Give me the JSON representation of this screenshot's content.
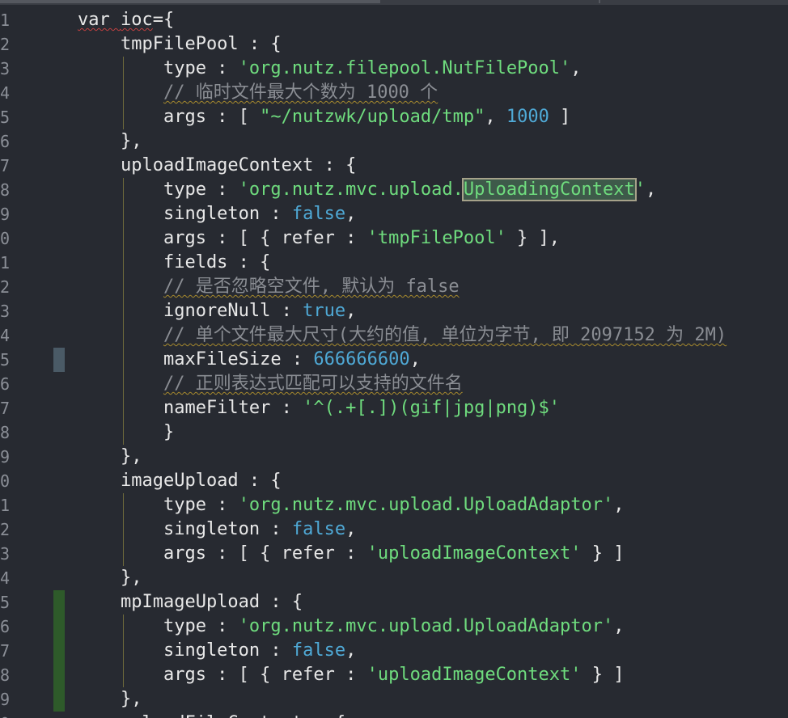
{
  "editor": {
    "lines": [
      {
        "n": "1",
        "tokens": [
          {
            "t": "var ",
            "c": "kw",
            "sq": "red"
          },
          {
            "t": "ioc",
            "c": "kw",
            "sq": "red"
          },
          {
            "t": "={",
            "c": "kw"
          }
        ]
      },
      {
        "n": "2",
        "tokens": [
          {
            "t": "    tmpFilePool : {",
            "c": "kw"
          }
        ]
      },
      {
        "n": "3",
        "tokens": [
          {
            "t": "        type : ",
            "c": "kw"
          },
          {
            "t": "'org.nutz.filepool.NutFilePool'",
            "c": "str"
          },
          {
            "t": ",",
            "c": "kw"
          }
        ]
      },
      {
        "n": "4",
        "tokens": [
          {
            "t": "        ",
            "c": "kw"
          },
          {
            "t": "// 临时文件最大个数为 1000 个",
            "c": "cmt",
            "sq": "y"
          }
        ]
      },
      {
        "n": "5",
        "tokens": [
          {
            "t": "        args : [ ",
            "c": "kw"
          },
          {
            "t": "\"~/nutzwk/upload/tmp\"",
            "c": "str"
          },
          {
            "t": ", ",
            "c": "kw"
          },
          {
            "t": "1000",
            "c": "num"
          },
          {
            "t": " ]",
            "c": "kw"
          }
        ]
      },
      {
        "n": "6",
        "tokens": [
          {
            "t": "    },",
            "c": "kw"
          }
        ]
      },
      {
        "n": "7",
        "tokens": [
          {
            "t": "    uploadImageContext : {",
            "c": "kw"
          }
        ]
      },
      {
        "n": "8",
        "tokens": [
          {
            "t": "        type : ",
            "c": "kw"
          },
          {
            "t": "'org.nutz.mvc.upload.",
            "c": "str"
          },
          {
            "t": "UploadingContext",
            "c": "str",
            "hl": true
          },
          {
            "t": "'",
            "c": "str"
          },
          {
            "t": ",",
            "c": "kw"
          }
        ]
      },
      {
        "n": "9",
        "tokens": [
          {
            "t": "        singleton : ",
            "c": "kw"
          },
          {
            "t": "false",
            "c": "bool"
          },
          {
            "t": ",",
            "c": "kw"
          }
        ]
      },
      {
        "n": "0",
        "tokens": [
          {
            "t": "        args : [ { refer : ",
            "c": "kw"
          },
          {
            "t": "'tmpFilePool'",
            "c": "str"
          },
          {
            "t": " } ],",
            "c": "kw"
          }
        ]
      },
      {
        "n": "1",
        "tokens": [
          {
            "t": "        fields : {",
            "c": "kw"
          }
        ]
      },
      {
        "n": "2",
        "tokens": [
          {
            "t": "        ",
            "c": "kw"
          },
          {
            "t": "// 是否忽略空文件, 默认为 false",
            "c": "cmt",
            "sq": "y"
          }
        ]
      },
      {
        "n": "3",
        "tokens": [
          {
            "t": "        ignoreNull : ",
            "c": "kw"
          },
          {
            "t": "true",
            "c": "bool"
          },
          {
            "t": ",",
            "c": "kw"
          }
        ]
      },
      {
        "n": "4",
        "tokens": [
          {
            "t": "        ",
            "c": "kw"
          },
          {
            "t": "// 单个文件最大尺寸(大约的值, 单位为字节, 即 2097152 为 2M)",
            "c": "cmt",
            "sq": "y"
          }
        ]
      },
      {
        "n": "5",
        "tokens": [
          {
            "t": "        maxFileSize : ",
            "c": "kw"
          },
          {
            "t": "666666600",
            "c": "num"
          },
          {
            "t": ",",
            "c": "kw"
          }
        ],
        "mark": "#4a5a66"
      },
      {
        "n": "6",
        "tokens": [
          {
            "t": "        ",
            "c": "kw"
          },
          {
            "t": "// 正则表达式匹配可以支持的文件名",
            "c": "cmt",
            "sq": "y"
          }
        ]
      },
      {
        "n": "7",
        "tokens": [
          {
            "t": "        nameFilter : ",
            "c": "kw"
          },
          {
            "t": "'^(.+[.])(gif|jpg|png)$'",
            "c": "str"
          }
        ]
      },
      {
        "n": "8",
        "tokens": [
          {
            "t": "        }",
            "c": "kw"
          }
        ]
      },
      {
        "n": "9",
        "tokens": [
          {
            "t": "    },",
            "c": "kw"
          }
        ]
      },
      {
        "n": "0",
        "tokens": [
          {
            "t": "    imageUpload : {",
            "c": "kw"
          }
        ]
      },
      {
        "n": "1",
        "tokens": [
          {
            "t": "        type : ",
            "c": "kw"
          },
          {
            "t": "'org.nutz.mvc.upload.UploadAdaptor'",
            "c": "str"
          },
          {
            "t": ",",
            "c": "kw"
          }
        ]
      },
      {
        "n": "2",
        "tokens": [
          {
            "t": "        singleton : ",
            "c": "kw"
          },
          {
            "t": "false",
            "c": "bool"
          },
          {
            "t": ",",
            "c": "kw"
          }
        ]
      },
      {
        "n": "3",
        "tokens": [
          {
            "t": "        args : [ { refer : ",
            "c": "kw"
          },
          {
            "t": "'uploadImageContext'",
            "c": "str"
          },
          {
            "t": " } ]",
            "c": "kw"
          }
        ]
      },
      {
        "n": "4",
        "tokens": [
          {
            "t": "    },",
            "c": "kw"
          }
        ]
      },
      {
        "n": "5",
        "tokens": [
          {
            "t": "    mpImageUpload : {",
            "c": "kw"
          }
        ],
        "mark": "#2e5a2a"
      },
      {
        "n": "6",
        "tokens": [
          {
            "t": "        type : ",
            "c": "kw"
          },
          {
            "t": "'org.nutz.mvc.upload.UploadAdaptor'",
            "c": "str"
          },
          {
            "t": ",",
            "c": "kw"
          }
        ],
        "mark": "#2e5a2a"
      },
      {
        "n": "7",
        "tokens": [
          {
            "t": "        singleton : ",
            "c": "kw"
          },
          {
            "t": "false",
            "c": "bool"
          },
          {
            "t": ",",
            "c": "kw"
          }
        ],
        "mark": "#2e5a2a"
      },
      {
        "n": "8",
        "tokens": [
          {
            "t": "        args : [ { refer : ",
            "c": "kw"
          },
          {
            "t": "'uploadImageContext'",
            "c": "str"
          },
          {
            "t": " } ]",
            "c": "kw"
          }
        ],
        "mark": "#2e5a2a"
      },
      {
        "n": "9",
        "tokens": [
          {
            "t": "    },",
            "c": "kw"
          }
        ],
        "mark": "#2e5a2a"
      },
      {
        "n": "0",
        "tokens": [
          {
            "t": "    uploadFileContext : {",
            "c": "kw"
          }
        ]
      }
    ]
  },
  "colors": {
    "background": "#272a31",
    "string": "#6fdc7e",
    "number": "#4fa9d6",
    "comment": "#8a8d93",
    "guide": "#6e6a3c"
  }
}
